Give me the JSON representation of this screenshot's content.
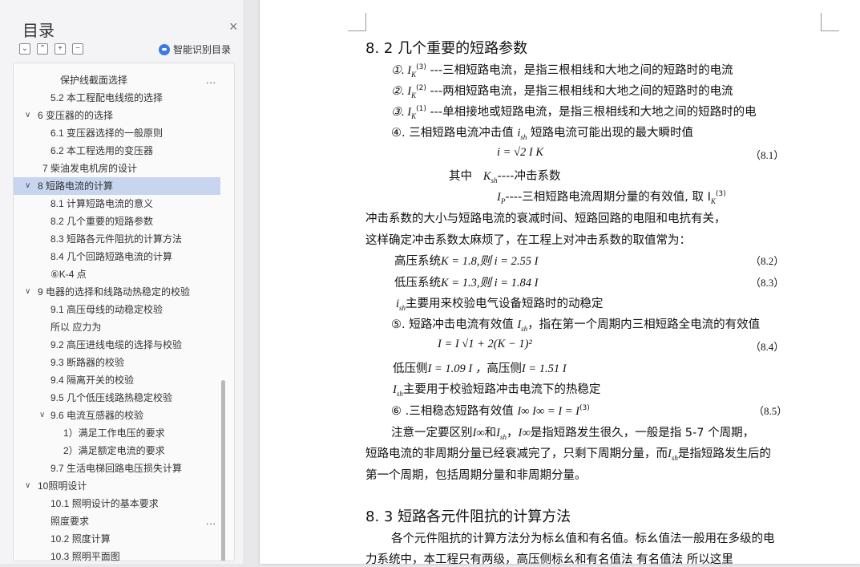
{
  "sidebar": {
    "title": "目录",
    "close": "×",
    "ai_label": "智能识别目录",
    "tools": [
      "⌄",
      "⌃",
      "+",
      "−"
    ],
    "items": [
      {
        "label": "保护线截面选择",
        "more": "..."
      },
      {
        "label": "5.2 本工程配电线缆的选择"
      },
      {
        "label": "6   变压器的的选择",
        "caret": "∨"
      },
      {
        "label": "6.1 变压器选择的一般原则"
      },
      {
        "label": "6.2 本工程选用的变压器"
      },
      {
        "label": "7   柴油发电机房的设计"
      },
      {
        "label": "8   短路电流的计算",
        "caret": "∨"
      },
      {
        "label": "8.1 计算短路电流的意义"
      },
      {
        "label": "8.2 几个重要的短路参数"
      },
      {
        "label": "8.3 短路各元件阻抗的计算方法"
      },
      {
        "label": "8.4    几个回路短路电流的计算"
      },
      {
        "label": "⑥K-4 点"
      },
      {
        "label": "9   电器的选择和线路动热稳定的校验",
        "caret": "∨"
      },
      {
        "label": "9.1 高压母线的动稳定校验"
      },
      {
        "label": "所以  应力为"
      },
      {
        "label": "9.2 高压进线电缆的选择与校验"
      },
      {
        "label": "9.3 断路器的校验"
      },
      {
        "label": "9.4 隔离开关的校验"
      },
      {
        "label": "9.5 几个低压线路热稳定校验"
      },
      {
        "label": "9.6 电流互感器的校验",
        "caret": "∨"
      },
      {
        "label": "1）满足工作电压的要求"
      },
      {
        "label": "2）满足额定电流的要求"
      },
      {
        "label": "9.7 生活电梯回路电压损失计算"
      },
      {
        "label": "10照明设计",
        "caret": "∨"
      },
      {
        "label": "10.1 照明设计的基本要求"
      },
      {
        "label": "照度要求",
        "more": "..."
      },
      {
        "label": "10.2 照度计算"
      },
      {
        "label": "10.3 照明平面图"
      }
    ]
  },
  "doc": {
    "h82": "8. 2 几个重要的短路参数",
    "l1": "①.   I",
    "l1b": "---三相短路电流，是指三根相线和大地之间的短路时的电流",
    "l2": "②.   I",
    "l2b": "---两相短路电流，是指三根相线和大地之间的短路时的电流",
    "l3": "③.   I",
    "l3b": "---单相接地或短路电流，是指三根相线和大地之间的短路时的电",
    "l4": "④.  三相短路电流冲击值",
    "l4b": "短路电流可能出现的最大瞬时值",
    "eq81": "i  = √2 I  K",
    "n81": "（8.1）",
    "where": "其中",
    "ksh": "K",
    "ksh_desc": "----冲击系数",
    "ip": "I",
    "ip_desc": "----三相短路电流周期分量的有效值, 取 I",
    "para1": "冲击系数的大小与短路电流的衰减时间、短路回路的电阻和电抗有关，",
    "para2": "这样确定冲击系数太麻烦了，在工程上对冲击系数的取值常为：",
    "hv": "高压系统",
    "hv_eq": "K   = 1.8,则 i   = 2.55 I",
    "n82": "（8.2）",
    "lv": "低压系统",
    "lv_eq": "K   = 1.3,则 i   = 1.84 I",
    "n83": "（8.3）",
    "ish_use": "主要用来校验电气设备短路时的动稳定",
    "l5": "⑤. 短路冲击电流有效值",
    "l5b": "，指在第一个周期内三相短路全电流的有效值",
    "eq84": "I   = I  √1 + 2(K   − 1)²",
    "n84": "（8.4）",
    "lowside": "低压侧",
    "lowside_eq": "I   = 1.09 I ，",
    "highside": "高压侧",
    "highside_eq": "I   = 1.51 I",
    "Ish_use": "主要用于校验短路冲击电流下的热稳定",
    "l6": "⑥ .三相稳态短路有效值",
    "eq85": "I∞   I∞ = I  = I",
    "n85": "（8.5）",
    "note1": "注意一定要区别",
    "note1b": "和",
    "note1c": "，",
    "note1d": "是指短路发生很久，一般是指 5-7 个周期，",
    "note2": "短路电流的非周期分量已经衰减完了，只剩下周期分量，而",
    "note2b": "是指短路发生后的",
    "note3": "第一个周期，包括周期分量和非周期分量。",
    "h83": "8. 3 短路各元件阻抗的计算方法",
    "para3": "各个元件阻抗的计算方法分为标幺值和有名值。标幺值法一般用在多级的电",
    "para4": "力系统中，本工程只有两级，高压侧标幺和有名值法  有名值法  所以这里"
  }
}
